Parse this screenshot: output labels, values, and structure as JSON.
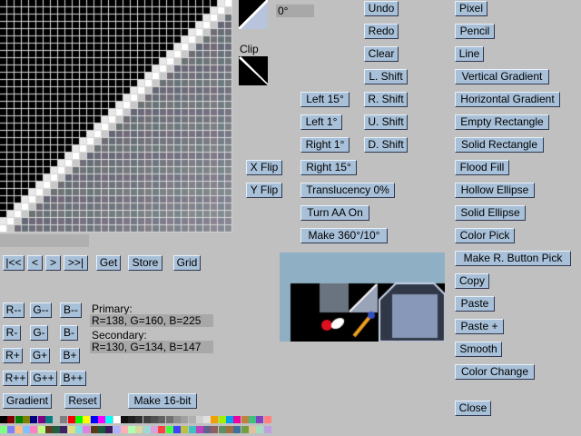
{
  "editor": {
    "angle_value": "0°",
    "clip_label": "Clip"
  },
  "nav": {
    "first": "|<<",
    "prev": "<",
    "next": ">",
    "last": ">>|",
    "get": "Get",
    "store": "Store",
    "grid": "Grid"
  },
  "color_buttons": {
    "r_dec2": "R--",
    "g_dec2": "G--",
    "b_dec2": "B--",
    "r_dec": "R-",
    "g_dec": "G-",
    "b_dec": "B-",
    "r_inc": "R+",
    "g_inc": "G+",
    "b_inc": "B+",
    "r_inc2": "R++",
    "g_inc2": "G++",
    "b_inc2": "B++"
  },
  "colors": {
    "primary_label": "Primary:",
    "primary_value": "R=138, G=160, B=225",
    "secondary_label": "Secondary:",
    "secondary_value": "R=130, G=134, B=147",
    "primary_hex": "#8aa0e1",
    "secondary_hex": "#828693",
    "button_face": "#a8c0d8",
    "window_bg": "#c0c0c0"
  },
  "bottom": {
    "gradient": "Gradient",
    "reset": "Reset",
    "make16": "Make 16-bit"
  },
  "transform": {
    "undo": "Undo",
    "redo": "Redo",
    "clear": "Clear",
    "l_shift": "L. Shift",
    "r_shift": "R. Shift",
    "u_shift": "U. Shift",
    "d_shift": "D. Shift",
    "left15": "Left 15°",
    "left1": "Left 1°",
    "right1": "Right 1°",
    "right15": "Right 15°",
    "x_flip": "X Flip",
    "y_flip": "Y Flip",
    "translucency": "Translucency 0%",
    "turn_aa": "Turn AA On",
    "make360": "Make 360°/10°"
  },
  "tools": {
    "pixel": "Pixel",
    "pencil": "Pencil",
    "line": "Line",
    "vgrad": "Vertical Gradient",
    "hgrad": "Horizontal Gradient",
    "empty_rect": "Empty Rectangle",
    "solid_rect": "Solid Rectangle",
    "flood_fill": "Flood Fill",
    "hollow_ellipse": "Hollow Ellipse",
    "solid_ellipse": "Solid Ellipse",
    "color_pick": "Color Pick",
    "make_rbutton": "Make R. Button Pick",
    "copy": "Copy",
    "paste": "Paste",
    "paste_plus": "Paste +",
    "smooth": "Smooth",
    "color_change": "Color Change",
    "close": "Close"
  },
  "palette": [
    "#000000",
    "#800000",
    "#008000",
    "#808000",
    "#000080",
    "#800080",
    "#008080",
    "#c0c0c0",
    "#808080",
    "#ff0000",
    "#00ff00",
    "#ffff00",
    "#0000ff",
    "#ff00ff",
    "#00ffff",
    "#ffffff",
    "#101010",
    "#202020",
    "#303030",
    "#404040",
    "#505050",
    "#606060",
    "#707070",
    "#909090",
    "#a0a0a0",
    "#b0b0b0",
    "#d0d0d0",
    "#e0e0e0",
    "#f0a000",
    "#a0f000",
    "#00a0f0",
    "#f000a0",
    "#c08040",
    "#40c080",
    "#8040c0",
    "#ff8080",
    "#80ff80",
    "#8080ff",
    "#ffc080",
    "#80c0ff",
    "#ff80c0",
    "#c0ff80",
    "#604020",
    "#206040",
    "#402060",
    "#e0e080",
    "#80e0e0",
    "#e080e0",
    "#5a3a1a",
    "#1a5a3a",
    "#3a1a5a",
    "#b0b0ff",
    "#ffb0b0",
    "#b0ffb0",
    "#d8d8a0",
    "#a0d8d8",
    "#d8a0d8",
    "#ff4040",
    "#40ff40",
    "#4040ff",
    "#c0c040",
    "#40c0c0",
    "#c040c0",
    "#606090",
    "#906060",
    "#609060",
    "#a07040",
    "#4070a0",
    "#70a040",
    "#e0c0a0",
    "#a0e0c0",
    "#c0a0e0"
  ]
}
